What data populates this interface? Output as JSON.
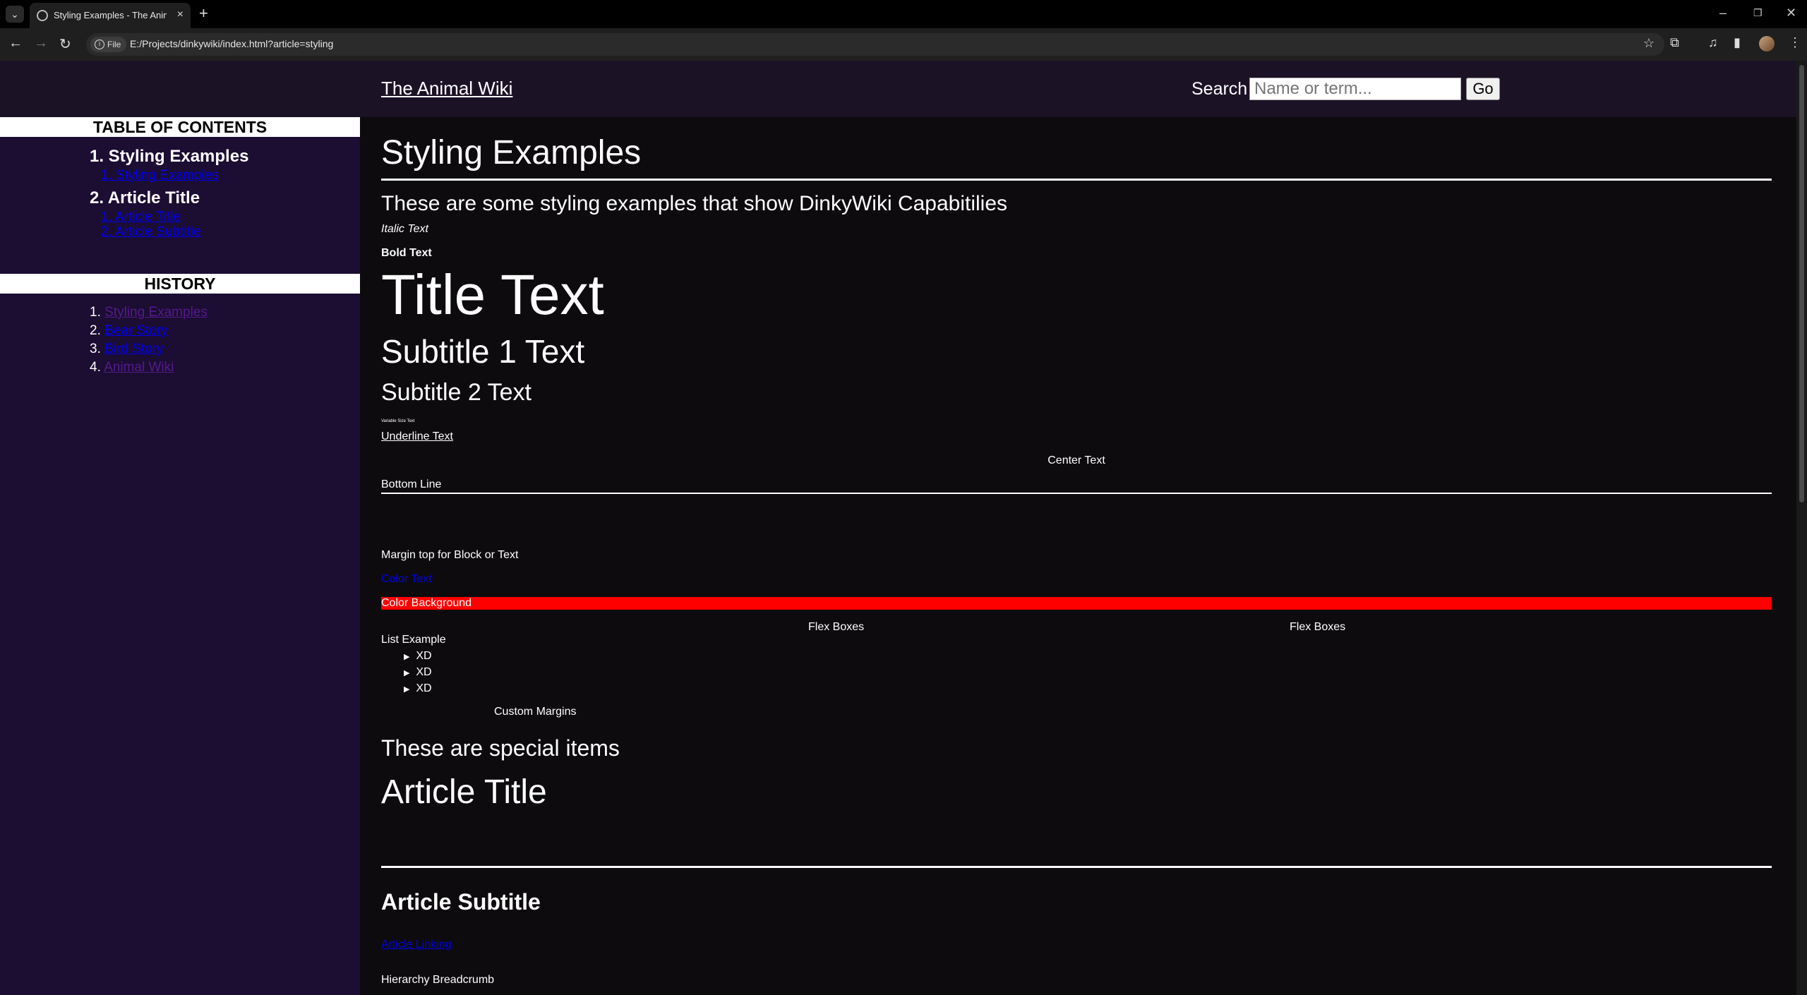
{
  "browser": {
    "tab_title": "Styling Examples - The Animal Wiki",
    "url_chip": "File",
    "url": "E:/Projects/dinkywiki/index.html?article=styling"
  },
  "header": {
    "site_title": "The Animal Wiki",
    "search_label": "Search",
    "search_placeholder": "Name or term...",
    "go_label": "Go"
  },
  "toc": {
    "heading": "TABLE OF CONTENTS",
    "sections": [
      {
        "label": "1. Styling Examples",
        "subs": [
          "1. Styling Examples"
        ]
      },
      {
        "label": "2. Article Title",
        "subs": [
          "1. Article Title",
          "2. Article Subtitle"
        ]
      }
    ]
  },
  "history": {
    "heading": "HISTORY",
    "items": [
      {
        "num": "1.",
        "label": "Styling Examples"
      },
      {
        "num": "2.",
        "label": "Bear Story"
      },
      {
        "num": "3.",
        "label": "Bird Story"
      },
      {
        "num": "4.",
        "label": "Animal Wiki"
      }
    ]
  },
  "article": {
    "title": "Styling Examples",
    "intro": "These are some styling examples that show DinkyWiki Capabitilies",
    "italic": "Italic Text",
    "bold": "Bold Text",
    "title_text": "Title Text",
    "subtitle1": "Subtitle 1 Text",
    "subtitle2": "Subtitle 2 Text",
    "variable": "Variable Size Text",
    "underline": "Underline Text",
    "center": "Center Text",
    "bottom_line": "Bottom Line",
    "margin_top": "Margin top for Block or Text",
    "color_text": "Color Text",
    "color_background": "Color Background",
    "flex1": "Flex Boxes",
    "flex2": "Flex Boxes",
    "list_heading": "List Example",
    "list_items": [
      "XD",
      "XD",
      "XD"
    ],
    "custom_margins": "Custom Margins",
    "special": "These are special items",
    "article_title": "Article Title",
    "article_subtitle": "Article Subtitle",
    "article_linking": "Article Linking",
    "breadcrumb_label": "Hierarchy Breadcrumb",
    "colors": {
      "link": "#0000ee",
      "visited": "#551a8b",
      "bg_red": "#ff0000"
    }
  }
}
